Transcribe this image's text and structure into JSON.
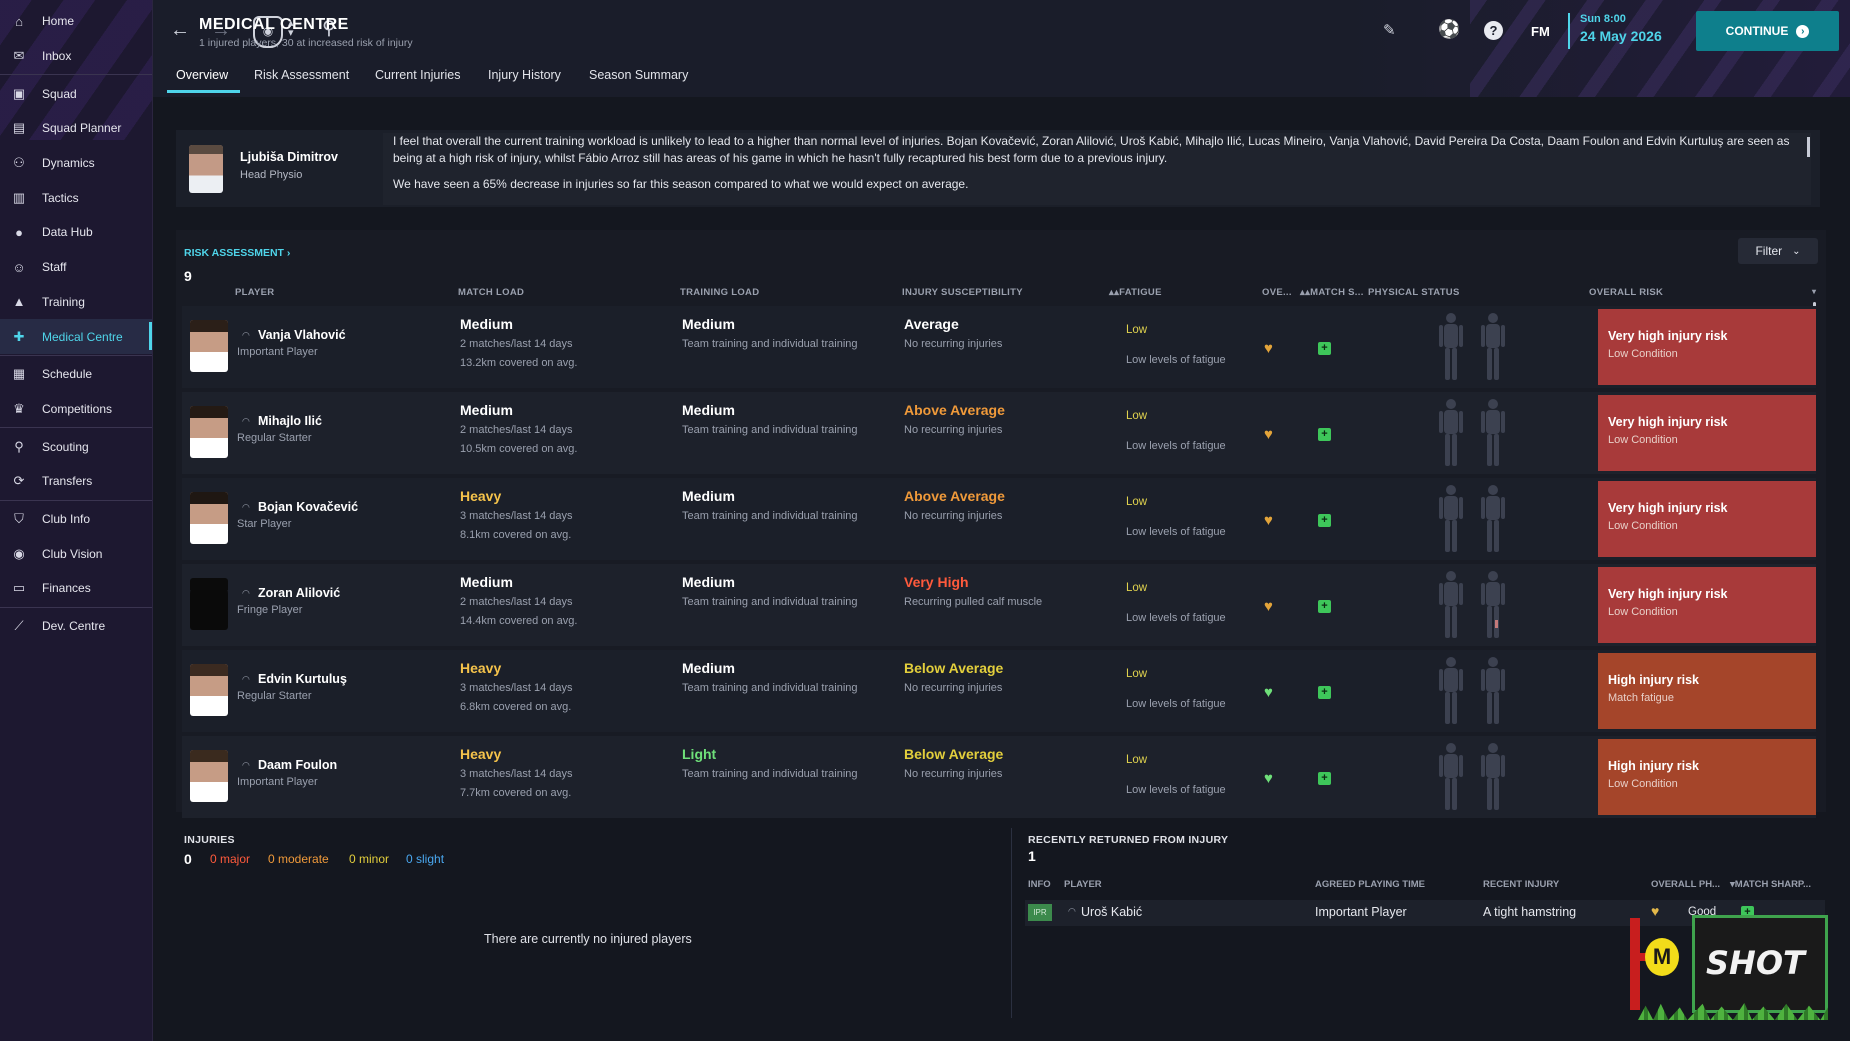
{
  "sidebar": {
    "items": [
      {
        "label": "Home",
        "icon": "home-icon"
      },
      {
        "label": "Inbox",
        "icon": "inbox-icon"
      },
      {
        "label": "Squad",
        "icon": "squad-icon"
      },
      {
        "label": "Squad Planner",
        "icon": "squad-planner-icon"
      },
      {
        "label": "Dynamics",
        "icon": "dynamics-icon"
      },
      {
        "label": "Tactics",
        "icon": "tactics-icon"
      },
      {
        "label": "Data Hub",
        "icon": "data-hub-icon"
      },
      {
        "label": "Staff",
        "icon": "staff-icon"
      },
      {
        "label": "Training",
        "icon": "training-icon"
      },
      {
        "label": "Medical Centre",
        "icon": "medical-icon"
      },
      {
        "label": "Schedule",
        "icon": "schedule-icon"
      },
      {
        "label": "Competitions",
        "icon": "trophy-icon"
      },
      {
        "label": "Scouting",
        "icon": "scouting-icon"
      },
      {
        "label": "Transfers",
        "icon": "transfers-icon"
      },
      {
        "label": "Club Info",
        "icon": "club-info-icon"
      },
      {
        "label": "Club Vision",
        "icon": "club-vision-icon"
      },
      {
        "label": "Finances",
        "icon": "finances-icon"
      },
      {
        "label": "Dev. Centre",
        "icon": "dev-centre-icon"
      }
    ]
  },
  "header": {
    "title": "MEDICAL CENTRE",
    "subtitle": "1 injured players, 30 at increased risk of injury",
    "tabs": [
      "Overview",
      "Risk Assessment",
      "Current Injuries",
      "Injury History",
      "Season Summary"
    ],
    "fm_label": "FM",
    "time": "Sun 8:00",
    "date": "24 May 2026",
    "continue_label": "CONTINUE"
  },
  "advisor": {
    "name": "Ljubiša Dimitrov",
    "role": "Head Physio",
    "text1": "I feel that overall the current training workload is unlikely to lead to a higher than normal level of injuries. Bojan Kovačević, Zoran Alilović, Uroš Kabić, Mihajlo Ilić, Lucas Mineiro, Vanja Vlahović, David Pereira Da Costa, Daam Foulon and Edvin Kurtuluş are seen as being at a high risk of injury, whilst Fábio Arroz still has areas of his game in which he hasn't fully recaptured his best form due to a previous injury.",
    "text2": "We have seen a 65% decrease in injuries so far this season compared to what we would expect on average."
  },
  "risk": {
    "section_label": "RISK ASSESSMENT",
    "count": "9",
    "filter_label": "Filter",
    "columns": [
      "PLAYER",
      "MATCH LOAD",
      "TRAINING LOAD",
      "INJURY SUSCEPTIBILITY",
      "FATIGUE",
      "OVE...",
      "MATCH S...",
      "PHYSICAL STATUS",
      "OVERALL RISK"
    ],
    "colors": {
      "heavy": "#f5c34b",
      "light": "#6fe07a",
      "above": "#f09a3a",
      "very_high": "#ff5a3c",
      "below": "#e3cf3c",
      "very_high_risk": "#a83a3a",
      "high_risk": "#a5452a"
    },
    "rows": [
      {
        "name": "Vanja Vlahović",
        "role": "Important Player",
        "match_load": "Medium",
        "matches": "2 matches/last 14 days",
        "covered": "13.2km covered on avg.",
        "training_load": "Medium",
        "training_desc": "Team training and individual training",
        "susceptibility": "Average",
        "recurring": "No recurring injuries",
        "fatigue": "Low",
        "fatigue_desc": "Low levels of fatigue",
        "risk": "Very high injury risk",
        "risk_reason": "Low Condition"
      },
      {
        "name": "Mihajlo Ilić",
        "role": "Regular Starter",
        "match_load": "Medium",
        "matches": "2 matches/last 14 days",
        "covered": "10.5km covered on avg.",
        "training_load": "Medium",
        "training_desc": "Team training and individual training",
        "susceptibility": "Above Average",
        "recurring": "No recurring injuries",
        "fatigue": "Low",
        "fatigue_desc": "Low levels of fatigue",
        "risk": "Very high injury risk",
        "risk_reason": "Low Condition"
      },
      {
        "name": "Bojan Kovačević",
        "role": "Star Player",
        "match_load": "Heavy",
        "matches": "3 matches/last 14 days",
        "covered": "8.1km covered on avg.",
        "training_load": "Medium",
        "training_desc": "Team training and individual training",
        "susceptibility": "Above Average",
        "recurring": "No recurring injuries",
        "fatigue": "Low",
        "fatigue_desc": "Low levels of fatigue",
        "risk": "Very high injury risk",
        "risk_reason": "Low Condition"
      },
      {
        "name": "Zoran Alilović",
        "role": "Fringe Player",
        "match_load": "Medium",
        "matches": "2 matches/last 14 days",
        "covered": "14.4km covered on avg.",
        "training_load": "Medium",
        "training_desc": "Team training and individual training",
        "susceptibility": "Very High",
        "recurring": "Recurring pulled calf muscle",
        "fatigue": "Low",
        "fatigue_desc": "Low levels of fatigue",
        "risk": "Very high injury risk",
        "risk_reason": "Low Condition"
      },
      {
        "name": "Edvin Kurtuluş",
        "role": "Regular Starter",
        "match_load": "Heavy",
        "matches": "3 matches/last 14 days",
        "covered": "6.8km covered on avg.",
        "training_load": "Medium",
        "training_desc": "Team training and individual training",
        "susceptibility": "Below Average",
        "recurring": "No recurring injuries",
        "fatigue": "Low",
        "fatigue_desc": "Low levels of fatigue",
        "risk": "High injury risk",
        "risk_reason": "Match fatigue"
      },
      {
        "name": "Daam Foulon",
        "role": "Important Player",
        "match_load": "Heavy",
        "matches": "3 matches/last 14 days",
        "covered": "7.7km covered on avg.",
        "training_load": "Light",
        "training_desc": "Team training and individual training",
        "susceptibility": "Below Average",
        "recurring": "No recurring injuries",
        "fatigue": "Low",
        "fatigue_desc": "Low levels of fatigue",
        "risk": "High injury risk",
        "risk_reason": "Low Condition"
      }
    ]
  },
  "injuries": {
    "label": "INJURIES",
    "count": "0",
    "major": "0 major",
    "moderate": "0 moderate",
    "minor": "0 minor",
    "slight": "0 slight",
    "empty": "There are currently no injured players"
  },
  "returned": {
    "label": "RECENTLY RETURNED FROM INJURY",
    "count": "1",
    "columns": [
      "INFO",
      "PLAYER",
      "AGREED PLAYING TIME",
      "RECENT INJURY",
      "OVERALL PH...",
      "MATCH SHARP..."
    ],
    "row": {
      "info": "IPR",
      "player": "Uroš Kabić",
      "playing_time": "Important Player",
      "injury": "A tight hamstring",
      "overall": "Good"
    }
  },
  "watermark": "SHOT"
}
